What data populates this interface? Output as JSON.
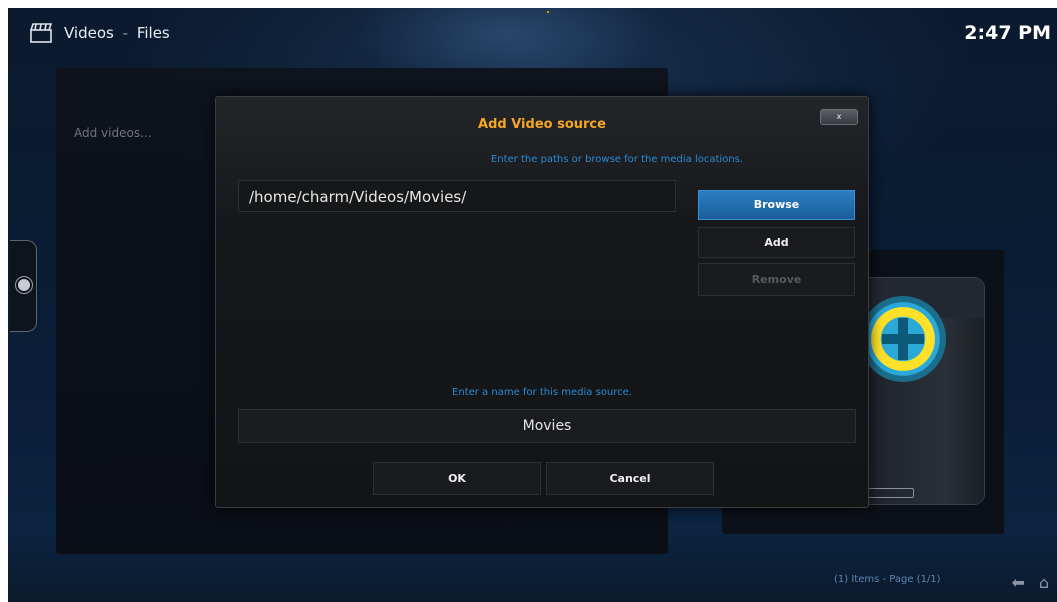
{
  "header": {
    "breadcrumb_section": "Videos",
    "breadcrumb_separator": "-",
    "breadcrumb_page": "Files",
    "clock": "2:47 PM",
    "section_icon": "clapperboard-icon"
  },
  "background": {
    "add_videos_label": "Add videos...",
    "status_text": "(1) Items - Page (1/1)",
    "back_icon": "back-arrow-icon",
    "home_icon": "home-icon"
  },
  "dialog": {
    "title": "Add Video source",
    "close_label": "x",
    "path_hint": "Enter the paths or browse for the media locations.",
    "path_value": "/home/charm/Videos/Movies/",
    "browse_label": "Browse",
    "add_label": "Add",
    "remove_label": "Remove",
    "name_hint": "Enter a name for this media source.",
    "name_value": "Movies",
    "ok_label": "OK",
    "cancel_label": "Cancel"
  },
  "colors": {
    "accent": "#f5a623",
    "hint": "#2a8ad4",
    "focus": "#2b7fc3"
  }
}
